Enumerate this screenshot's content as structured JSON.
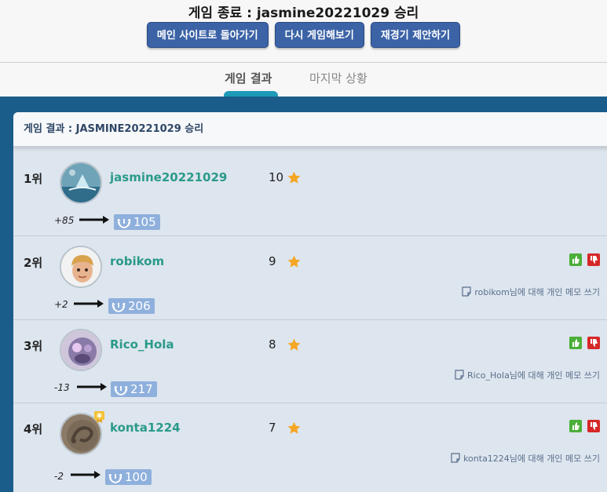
{
  "header": {
    "title": "게임 종료 : jasmine20221029 승리",
    "buttons": [
      "메인 사이트로 돌아가기",
      "다시 게임해보기",
      "재경기 제안하기"
    ]
  },
  "tabs": [
    "게임 결과",
    "마지막 상황"
  ],
  "panel": {
    "title": "게임 결과 : JASMINE20221029 승리"
  },
  "players": [
    {
      "rank": "1위",
      "name": "jasmine20221029",
      "score": "10",
      "delta": "+85",
      "rating": "105",
      "memo": ""
    },
    {
      "rank": "2위",
      "name": "robikom",
      "score": "9",
      "delta": "+2",
      "rating": "206",
      "memo": "robikom님에 대해 개인 메모 쓰기"
    },
    {
      "rank": "3위",
      "name": "Rico_Hola",
      "score": "8",
      "delta": "-13",
      "rating": "217",
      "memo": "Rico_Hola님에 대해 개인 메모 쓰기"
    },
    {
      "rank": "4위",
      "name": "konta1224",
      "score": "7",
      "delta": "-2",
      "rating": "100",
      "memo": "konta1224님에 대해 개인 메모 쓰기"
    }
  ],
  "colors": {
    "accent": "#3b63a6",
    "frame": "#1a5d8a",
    "player_name": "#2a9a8a",
    "star": "#f5a623",
    "rating_badge": "#8fb0dc"
  },
  "icons": {
    "star": "star-icon",
    "arrow": "arrow-right-icon",
    "laurel": "laurel-icon",
    "memo": "note-icon",
    "thumbs_up": "thumbs-up-icon",
    "thumbs_down": "thumbs-down-icon"
  }
}
